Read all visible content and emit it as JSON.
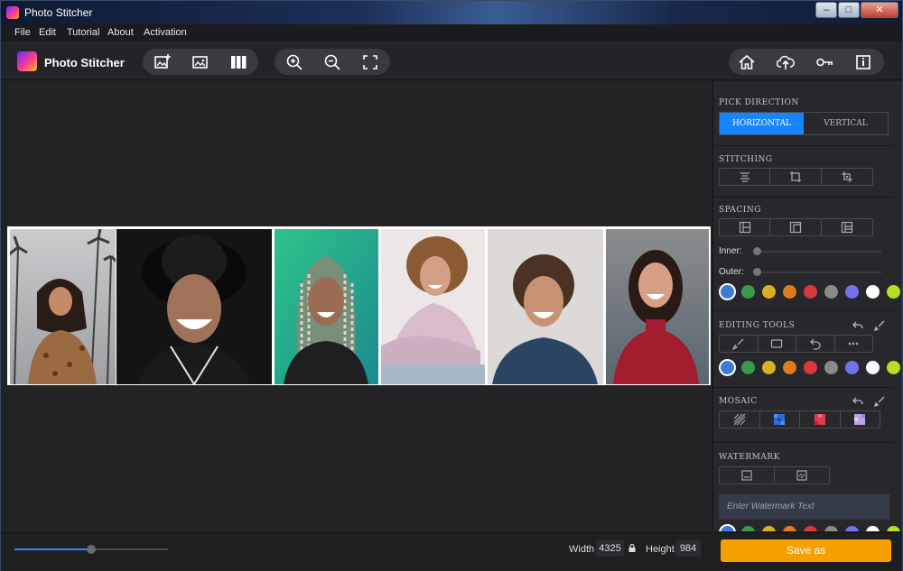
{
  "window": {
    "title": "Photo Stitcher",
    "minimize_glyph": "–",
    "maximize_glyph": "□",
    "close_glyph": "✕"
  },
  "menu": {
    "items": [
      "File",
      "Edit",
      "Tutorial",
      "About",
      "Activation"
    ]
  },
  "toolbar": {
    "app_name": "Photo Stitcher",
    "left_tools": [
      "add-image-icon",
      "replace-image-icon",
      "columns-icon"
    ],
    "zoom_tools": [
      "zoom-in-icon",
      "zoom-out-icon",
      "fit-screen-icon"
    ],
    "right_tools": [
      "home-icon",
      "upload-icon",
      "key-icon",
      "info-icon"
    ]
  },
  "canvas": {
    "photos": [
      {
        "name": "woman-palm-trees",
        "colors": [
          "#b9bcc0",
          "#8c6b55"
        ]
      },
      {
        "name": "man-hat-smiling",
        "colors": [
          "#151515",
          "#3b2a22"
        ]
      },
      {
        "name": "woman-braids",
        "colors": [
          "#27b07a",
          "#1d1d1f"
        ]
      },
      {
        "name": "woman-pink-sweater",
        "colors": [
          "#e8e4e6",
          "#c9a8b0"
        ]
      },
      {
        "name": "man-blue-sweater",
        "colors": [
          "#d9d6d3",
          "#2a4462"
        ]
      },
      {
        "name": "woman-red-top",
        "colors": [
          "#6b7a85",
          "#a51d2e"
        ]
      }
    ]
  },
  "panel": {
    "pick_direction": {
      "title": "PICK DIRECTION",
      "options": [
        "HORIZONTAL",
        "VERTICAL"
      ],
      "selected": "HORIZONTAL"
    },
    "stitching": {
      "title": "STITCHING",
      "icons": [
        "align-center-icon",
        "crop-icon",
        "crop-alt-icon"
      ]
    },
    "spacing": {
      "title": "SPACING",
      "icons": [
        "spacing-left-icon",
        "spacing-inner-icon",
        "spacing-right-icon"
      ],
      "inner_label": "Inner:",
      "outer_label": "Outer:",
      "inner_value": 0,
      "outer_value": 0
    },
    "colors": [
      "#3d7bd9",
      "#3a9a4a",
      "#d9b020",
      "#e07a1f",
      "#d9393b",
      "#8a8a8a",
      "#6f74e8",
      "#ffffff",
      "#b6e020"
    ],
    "editing_tools": {
      "title": "EDITING TOOLS",
      "icons": [
        "brush-icon",
        "rectangle-icon",
        "undo-icon",
        "more-icon"
      ]
    },
    "mosaic": {
      "title": "MOSAIC",
      "icons": [
        "pattern-lines-icon",
        "mosaic-blue-icon",
        "mosaic-red-icon",
        "mosaic-lilac-icon"
      ]
    },
    "watermark": {
      "title": "WATERMARK",
      "icons": [
        "text-watermark-icon",
        "image-watermark-icon"
      ],
      "placeholder": "Enter Watermark Text"
    }
  },
  "bottom": {
    "zoom_fraction": 0.5,
    "width_label": "Width",
    "width_value": "4325",
    "height_label": "Height",
    "height_value": "984",
    "save_label": "Save as"
  }
}
